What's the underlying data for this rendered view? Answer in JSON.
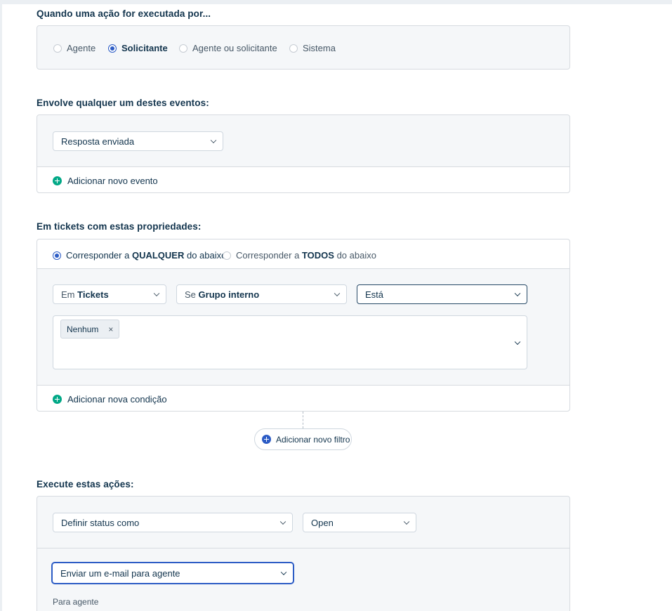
{
  "trigger": {
    "title": "Quando uma ação for executada por...",
    "options": [
      {
        "label": "Agente",
        "selected": false
      },
      {
        "label": "Solicitante",
        "selected": true
      },
      {
        "label": "Agente ou solicitante",
        "selected": false
      },
      {
        "label": "Sistema",
        "selected": false
      }
    ]
  },
  "events": {
    "title": "Envolve qualquer um destes eventos:",
    "selected_event": "Resposta enviada",
    "add_label": "Adicionar novo evento"
  },
  "conditions": {
    "title": "Em tickets com estas propriedades:",
    "match_any": {
      "prefix": "Corresponder a",
      "keyword": "QUALQUER",
      "suffix": "do abaixo",
      "selected": true
    },
    "match_all": {
      "prefix": "Corresponder a",
      "keyword": "TODOS",
      "suffix": "do abaixo",
      "selected": false
    },
    "in_prefix": "Em",
    "in_value": "Tickets",
    "if_prefix": "Se",
    "if_value": "Grupo interno",
    "operator": "Está",
    "values": [
      {
        "label": "Nenhum",
        "remove": "×"
      }
    ],
    "add_label": "Adicionar nova condição"
  },
  "filter": {
    "add_label": "Adicionar novo filtro"
  },
  "actions": {
    "title": "Execute estas ações:",
    "action1": "Definir status como",
    "action1_value": "Open",
    "action2": "Enviar um e-mail para agente",
    "action2_sublabel": "Para agente"
  },
  "colors": {
    "accent": "#2c5cc5",
    "add_green": "#00a886",
    "text": "#12344d"
  }
}
